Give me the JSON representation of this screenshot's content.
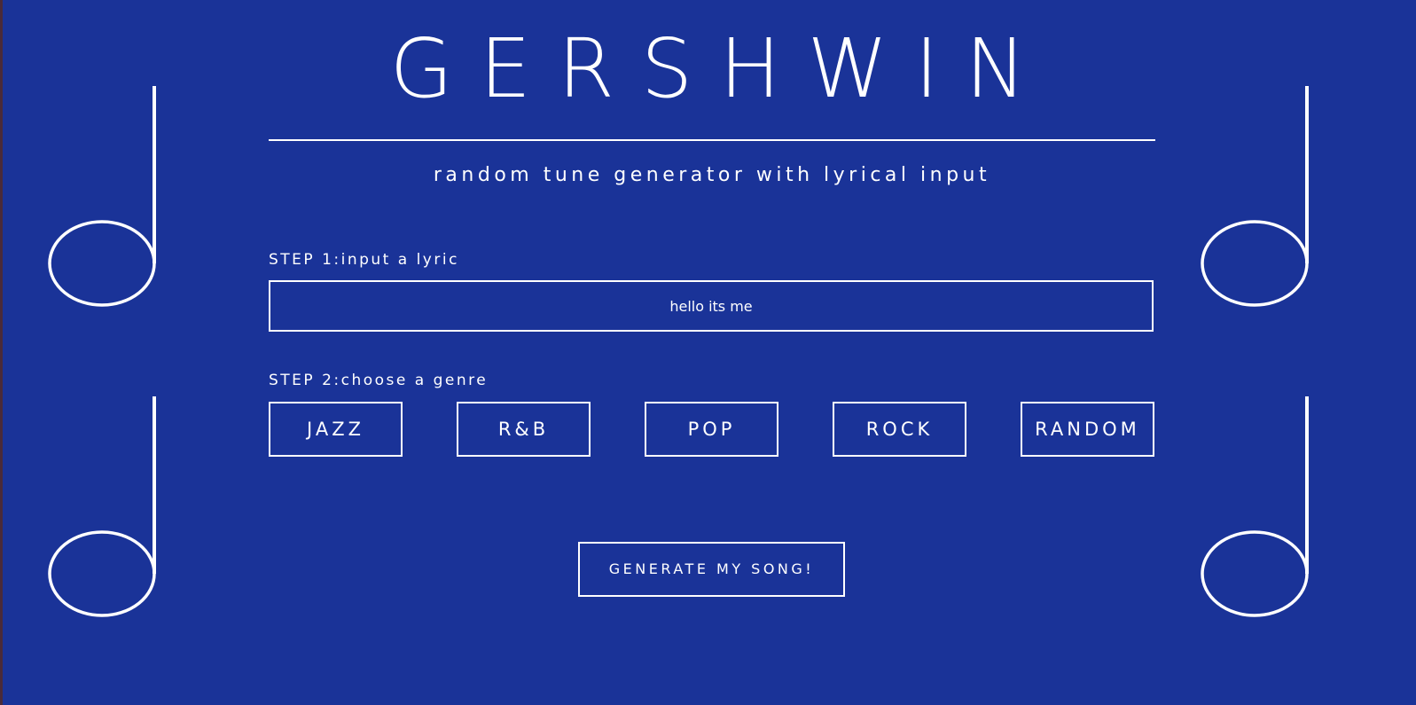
{
  "app": {
    "title": "GERSHWIN",
    "subtitle": "random tune generator with lyrical input"
  },
  "step1": {
    "label": "STEP 1:input a lyric",
    "lyric_value": "hello its me"
  },
  "step2": {
    "label": "STEP 2:choose a genre",
    "genres": [
      "JAZZ",
      "R&B",
      "POP",
      "ROCK",
      "RANDOM"
    ]
  },
  "generate": {
    "label": "GENERATE MY SONG!"
  },
  "decorations": {
    "icon": "half-note-icon"
  },
  "colors": {
    "background": "#1a3398",
    "foreground": "#ffffff"
  }
}
